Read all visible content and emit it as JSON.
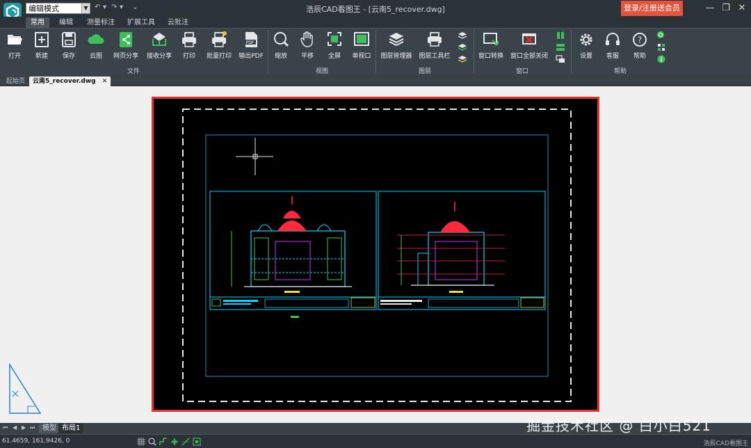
{
  "window": {
    "title": "浩辰CAD看图王 - [云南5_recover.dwg]",
    "mode": "编辑模式",
    "login_button": "登录/注册送会员"
  },
  "menu_tabs": [
    "常用",
    "编辑",
    "测量标注",
    "扩展工具",
    "云批注"
  ],
  "ribbon": {
    "tools": [
      "打开",
      "新建",
      "保存",
      "云图",
      "网页分享",
      "接收分享",
      "打印",
      "批量打印",
      "输出PDF",
      "缩放",
      "平移",
      "全屏",
      "单视口",
      "图层管理器",
      "图层工具栏",
      "窗口转换",
      "窗口全部关闭",
      "设置",
      "客服",
      "帮助"
    ],
    "groups": [
      "文件",
      "视图",
      "图层",
      "窗口",
      "帮助"
    ],
    "pdf_badge": "PDF"
  },
  "doc_tabs": [
    "起始页",
    "云南5_recover.dwg"
  ],
  "layout_tabs": [
    "模型",
    "布局1"
  ],
  "status": {
    "coords": "61.4659, 161.9426, 0",
    "app_name": "浩辰CAD看图王"
  },
  "watermark": "掘金技术社区 @ 白小白521",
  "colors": {
    "accent": "#e8302a",
    "login_bg": "#e2543d",
    "cad_cyan": "#00d7ff",
    "cad_red": "#ff2a3a"
  }
}
